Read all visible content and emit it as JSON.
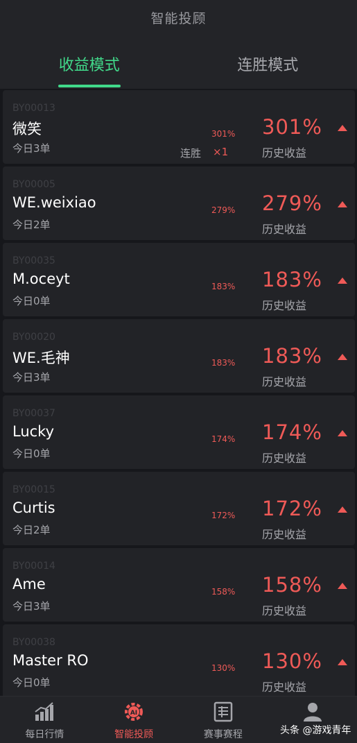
{
  "header": {
    "title": "智能投顾"
  },
  "tabs": [
    {
      "label": "收益模式",
      "active": true
    },
    {
      "label": "连胜模式",
      "active": false
    }
  ],
  "cards": [
    {
      "id": "BY00013",
      "name": "微笑",
      "today": "今日3单",
      "small_pct": "301%",
      "streak_label": "连胜",
      "streak_mult": "×1",
      "big_pct": "301%",
      "hist_label": "历史收益"
    },
    {
      "id": "BY00005",
      "name": "WE.weixiao",
      "today": "今日2单",
      "small_pct": "279%",
      "big_pct": "279%",
      "hist_label": "历史收益"
    },
    {
      "id": "BY00035",
      "name": "M.oceyt",
      "today": "今日0单",
      "small_pct": "183%",
      "big_pct": "183%",
      "hist_label": "历史收益"
    },
    {
      "id": "BY00020",
      "name": "WE.毛神",
      "today": "今日3单",
      "small_pct": "183%",
      "big_pct": "183%",
      "hist_label": "历史收益"
    },
    {
      "id": "BY00037",
      "name": "Lucky",
      "today": "今日0单",
      "small_pct": "174%",
      "big_pct": "174%",
      "hist_label": "历史收益"
    },
    {
      "id": "BY00015",
      "name": "Curtis",
      "today": "今日2单",
      "small_pct": "172%",
      "big_pct": "172%",
      "hist_label": "历史收益"
    },
    {
      "id": "BY00014",
      "name": "Ame",
      "today": "今日3单",
      "small_pct": "158%",
      "big_pct": "158%",
      "hist_label": "历史收益"
    },
    {
      "id": "BY00038",
      "name": "Master  RO",
      "today": "今日0单",
      "small_pct": "130%",
      "big_pct": "130%",
      "hist_label": "历史收益"
    }
  ],
  "nav": [
    {
      "label": "每日行情",
      "icon": "bar-chart-icon",
      "active": false
    },
    {
      "label": "智能投顾",
      "icon": "ai-gear-icon",
      "active": true
    },
    {
      "label": "赛事赛程",
      "icon": "schedule-icon",
      "active": false
    },
    {
      "label": "",
      "icon": "user-icon",
      "active": false
    }
  ],
  "watermark": "头条 @游戏青年",
  "colors": {
    "accent_green": "#41d98a",
    "accent_red": "#ef5a57",
    "background": "#16171b",
    "card": "#222327"
  }
}
